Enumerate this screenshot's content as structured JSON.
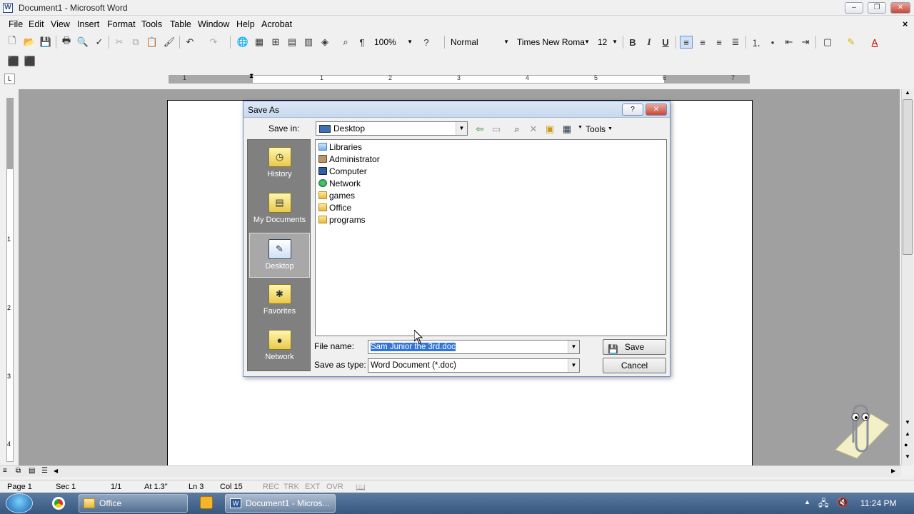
{
  "window": {
    "title": "Document1 - Microsoft Word",
    "minimize": "–",
    "restore": "❐",
    "close": "✕"
  },
  "menu": [
    "File",
    "Edit",
    "View",
    "Insert",
    "Format",
    "Tools",
    "Table",
    "Window",
    "Help",
    "Acrobat"
  ],
  "menu_close": "×",
  "toolbar": {
    "zoom": "100%",
    "style": "Normal",
    "font": "Times New Roma",
    "size": "12",
    "bold": "B",
    "italic": "I",
    "underline": "U"
  },
  "ruler": {
    "tab_selector": "L",
    "numbers": [
      "1",
      "1",
      "2",
      "3",
      "4",
      "5",
      "6",
      "7"
    ]
  },
  "vruler_numbers": [
    "1",
    "2",
    "3",
    "4"
  ],
  "dialog": {
    "title": "Save As",
    "help": "?",
    "close": "✕",
    "save_in_label": "Save in:",
    "save_in_value": "Desktop",
    "tools_label": "Tools",
    "places": [
      "History",
      "My Documents",
      "Desktop",
      "Favorites",
      "Network"
    ],
    "selected_place": "Desktop",
    "files": [
      "Libraries",
      "Administrator",
      "Computer",
      "Network",
      "games",
      "Office",
      "programs"
    ],
    "file_name_label": "File name:",
    "file_name_value": "Sam Junior the 3rd.doc",
    "save_type_label": "Save as type:",
    "save_type_value": "Word Document (*.doc)",
    "save_button": "Save",
    "cancel_button": "Cancel"
  },
  "status": {
    "page": "Page  1",
    "sec": "Sec  1",
    "pages": "1/1",
    "at": "At  1.3\"",
    "ln": "Ln  3",
    "col": "Col  15",
    "rec": "REC",
    "trk": "TRK",
    "ext": "EXT",
    "ovr": "OVR"
  },
  "taskbar": {
    "office": "Office",
    "document": "Document1 - Micros...",
    "clock": "11:24 PM"
  }
}
